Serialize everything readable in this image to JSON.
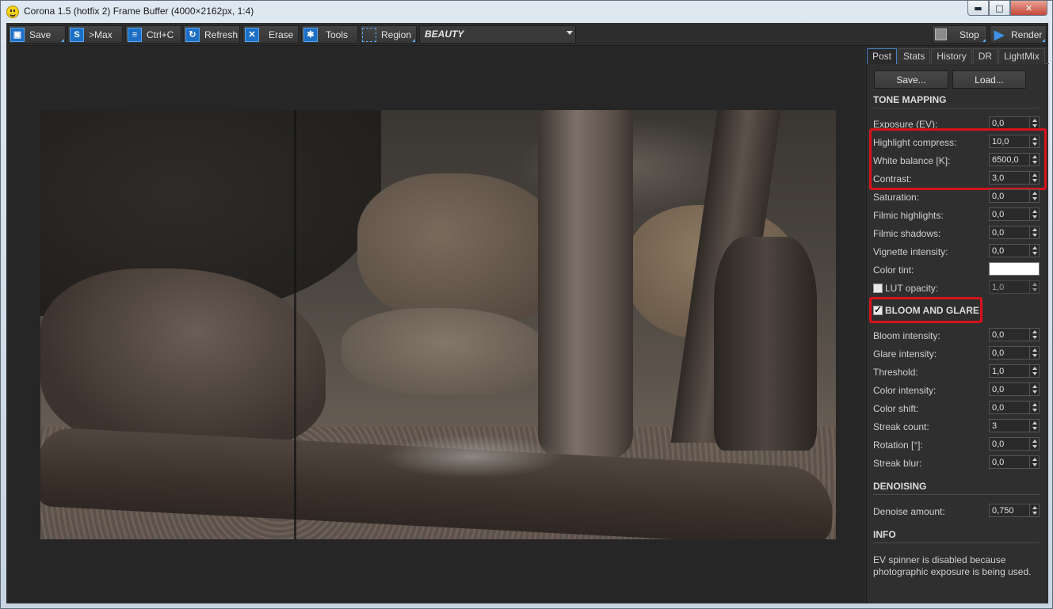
{
  "window": {
    "title": "Corona 1.5 (hotfix 2) Frame Buffer (4000×2162px, 1:4)",
    "controls": {
      "minimize": "▬",
      "maximize": "□",
      "close": "✕"
    }
  },
  "toolbar": {
    "save": "Save",
    "max": ">Max",
    "copy": "Ctrl+C",
    "refresh": "Refresh",
    "erase": "Erase",
    "tools": "Tools",
    "region": "Region",
    "pass": "BEAUTY",
    "stop": "Stop",
    "render": "Render"
  },
  "tabs": [
    "Post",
    "Stats",
    "History",
    "DR",
    "LightMix"
  ],
  "buttons": {
    "save": "Save...",
    "load": "Load..."
  },
  "tone_mapping": {
    "title": "TONE MAPPING",
    "exposure_label": "Exposure (EV):",
    "exposure": "0,0",
    "highlight_label": "Highlight compress:",
    "highlight": "10,0",
    "white_balance_label": "White balance [K]:",
    "white_balance": "6500,0",
    "contrast_label": "Contrast:",
    "contrast": "3,0",
    "saturation_label": "Saturation:",
    "saturation": "0,0",
    "filmic_highlights_label": "Filmic highlights:",
    "filmic_highlights": "0,0",
    "filmic_shadows_label": "Filmic shadows:",
    "filmic_shadows": "0,0",
    "vignette_label": "Vignette intensity:",
    "vignette": "0,0",
    "color_tint_label": "Color tint:",
    "color_tint": "#ffffff",
    "lut_label": "LUT opacity:",
    "lut": "1,0"
  },
  "bloom": {
    "title": "BLOOM AND GLARE",
    "bloom_label": "Bloom intensity:",
    "bloom": "0,0",
    "glare_label": "Glare intensity:",
    "glare": "0,0",
    "threshold_label": "Threshold:",
    "threshold": "1,0",
    "color_intensity_label": "Color intensity:",
    "color_intensity": "0,0",
    "color_shift_label": "Color shift:",
    "color_shift": "0,0",
    "streak_count_label": "Streak count:",
    "streak_count": "3",
    "rotation_label": "Rotation [°]:",
    "rotation": "0,0",
    "streak_blur_label": "Streak blur:",
    "streak_blur": "0,0"
  },
  "denoising": {
    "title": "DENOISING",
    "amount_label": "Denoise amount:",
    "amount": "0,750"
  },
  "info": {
    "title": "INFO",
    "text": "EV spinner is disabled because photographic exposure is being used."
  },
  "colors": {
    "accent": "#1c6fc4",
    "highlight": "#d8121b",
    "panel": "#2f2f2f"
  }
}
